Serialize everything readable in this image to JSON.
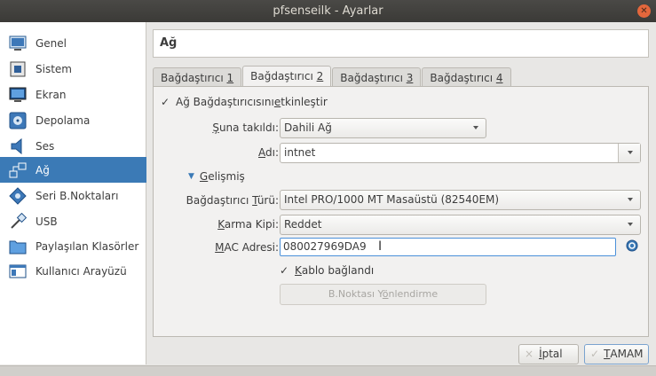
{
  "window": {
    "title": "pfsenseilk - Ayarlar"
  },
  "sidebar": {
    "items": [
      {
        "label": "Genel",
        "icon": "general-monitor-icon"
      },
      {
        "label": "Sistem",
        "icon": "system-chip-icon"
      },
      {
        "label": "Ekran",
        "icon": "display-monitor-icon"
      },
      {
        "label": "Depolama",
        "icon": "storage-disk-icon"
      },
      {
        "label": "Ses",
        "icon": "audio-speaker-icon"
      },
      {
        "label": "Ağ",
        "icon": "network-icon",
        "active": true
      },
      {
        "label": "Seri B.Noktaları",
        "icon": "serial-port-icon"
      },
      {
        "label": "USB",
        "icon": "usb-plug-icon"
      },
      {
        "label": "Paylaşılan Klasörler",
        "icon": "shared-folder-icon"
      },
      {
        "label": "Kullanıcı Arayüzü",
        "icon": "user-interface-icon"
      }
    ]
  },
  "page": {
    "title": "Ağ"
  },
  "tabs": [
    {
      "pre": "Bağdaştırıcı ",
      "key": "1"
    },
    {
      "pre": "Bağdaştırıcı ",
      "key": "2",
      "active": true
    },
    {
      "pre": "Bağdaştırıcı ",
      "key": "3"
    },
    {
      "pre": "Bağdaştırıcı ",
      "key": "4"
    }
  ],
  "adapter": {
    "enable": {
      "pre": "Ağ Bağdaştırıcısını ",
      "key": "e",
      "post": "tkinleştir",
      "checked": true
    },
    "attached": {
      "pre": "",
      "key": "Ş",
      "post": "una takıldı:",
      "value": "Dahili Ağ"
    },
    "name": {
      "pre": "",
      "key": "A",
      "post": "dı:",
      "value": "intnet"
    },
    "advanced": {
      "pre": "",
      "key": "G",
      "post": "elişmiş"
    },
    "type": {
      "pre": "Bağdaştırıcı ",
      "key": "T",
      "post": "ürü:",
      "value": "Intel PRO/1000 MT Masaüstü (82540EM)"
    },
    "promisc": {
      "pre": "",
      "key": "K",
      "post": "arma Kipi:",
      "value": "Reddet"
    },
    "mac": {
      "pre": "",
      "key": "M",
      "post": "AC Adresi:",
      "value": "080027969DA9"
    },
    "cable": {
      "pre": "",
      "key": "K",
      "post": "ablo bağlandı",
      "checked": true
    },
    "port_forward": {
      "pre": "B.Noktası Y",
      "key": "ö",
      "post": "nlendirme"
    }
  },
  "buttons": {
    "cancel": {
      "pre": "",
      "key": "İ",
      "post": "ptal"
    },
    "ok": {
      "pre": "",
      "key": "T",
      "post": "AMAM"
    }
  },
  "colors": {
    "accent": "#3b7ab6",
    "titlebar": "#3b3a37",
    "close": "#e4673c"
  }
}
